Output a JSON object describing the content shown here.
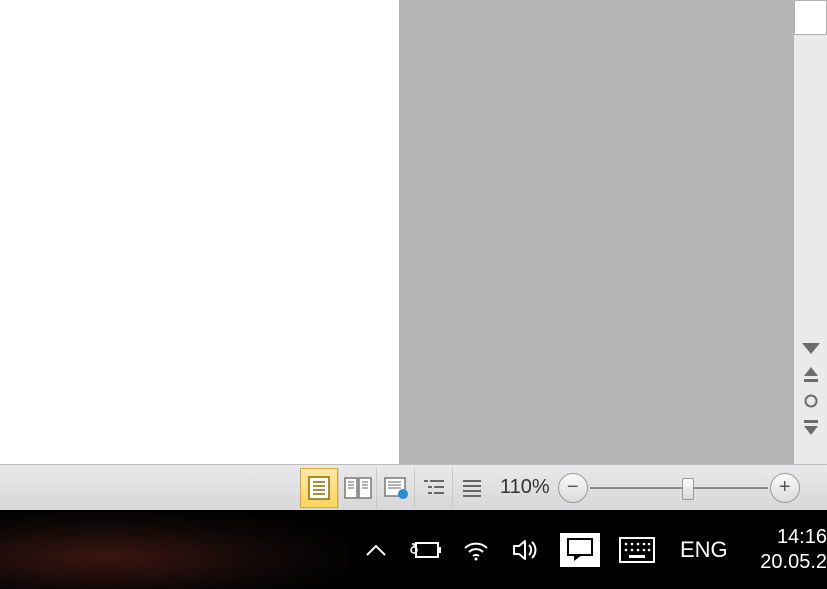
{
  "statusbar": {
    "zoom_label": "110%"
  },
  "taskbar": {
    "language": "ENG",
    "time": "14:16",
    "date": "20.05.2"
  },
  "icons": {
    "chevron_up": "▲",
    "minus": "−",
    "plus": "+"
  }
}
